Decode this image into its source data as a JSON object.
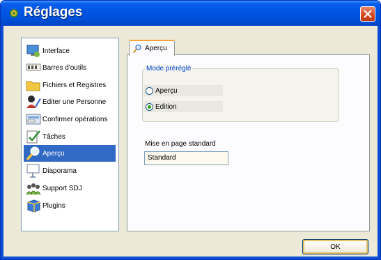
{
  "window": {
    "title": "Réglages"
  },
  "sidebar": {
    "items": [
      {
        "label": "Interface",
        "icon": "interface-icon"
      },
      {
        "label": "Barres d'outils",
        "icon": "toolbars-icon"
      },
      {
        "label": "Fichiers et Registres",
        "icon": "folder-icon"
      },
      {
        "label": "Editer une Personne",
        "icon": "edit-person-icon"
      },
      {
        "label": "Confirmer opérations",
        "icon": "confirm-icon"
      },
      {
        "label": "Tâches",
        "icon": "tasks-icon"
      },
      {
        "label": "Aperçu",
        "icon": "preview-icon",
        "selected": true
      },
      {
        "label": "Diaporama",
        "icon": "slideshow-icon"
      },
      {
        "label": "Support SDJ",
        "icon": "support-icon"
      },
      {
        "label": "Plugins",
        "icon": "plugins-icon"
      }
    ]
  },
  "tab": {
    "label": "Aperçu"
  },
  "mode_group": {
    "legend": "Mode préréglé",
    "options": [
      {
        "label": "Aperçu",
        "checked": false
      },
      {
        "label": "Edition",
        "checked": true
      }
    ]
  },
  "layout_field": {
    "label": "Mise en page standard",
    "value": "Standard"
  },
  "ok_button": {
    "label": "OK"
  },
  "colors": {
    "titlebar": "#0054e3",
    "selection": "#316ac5",
    "close": "#d4461d",
    "legend": "#0046d5"
  }
}
